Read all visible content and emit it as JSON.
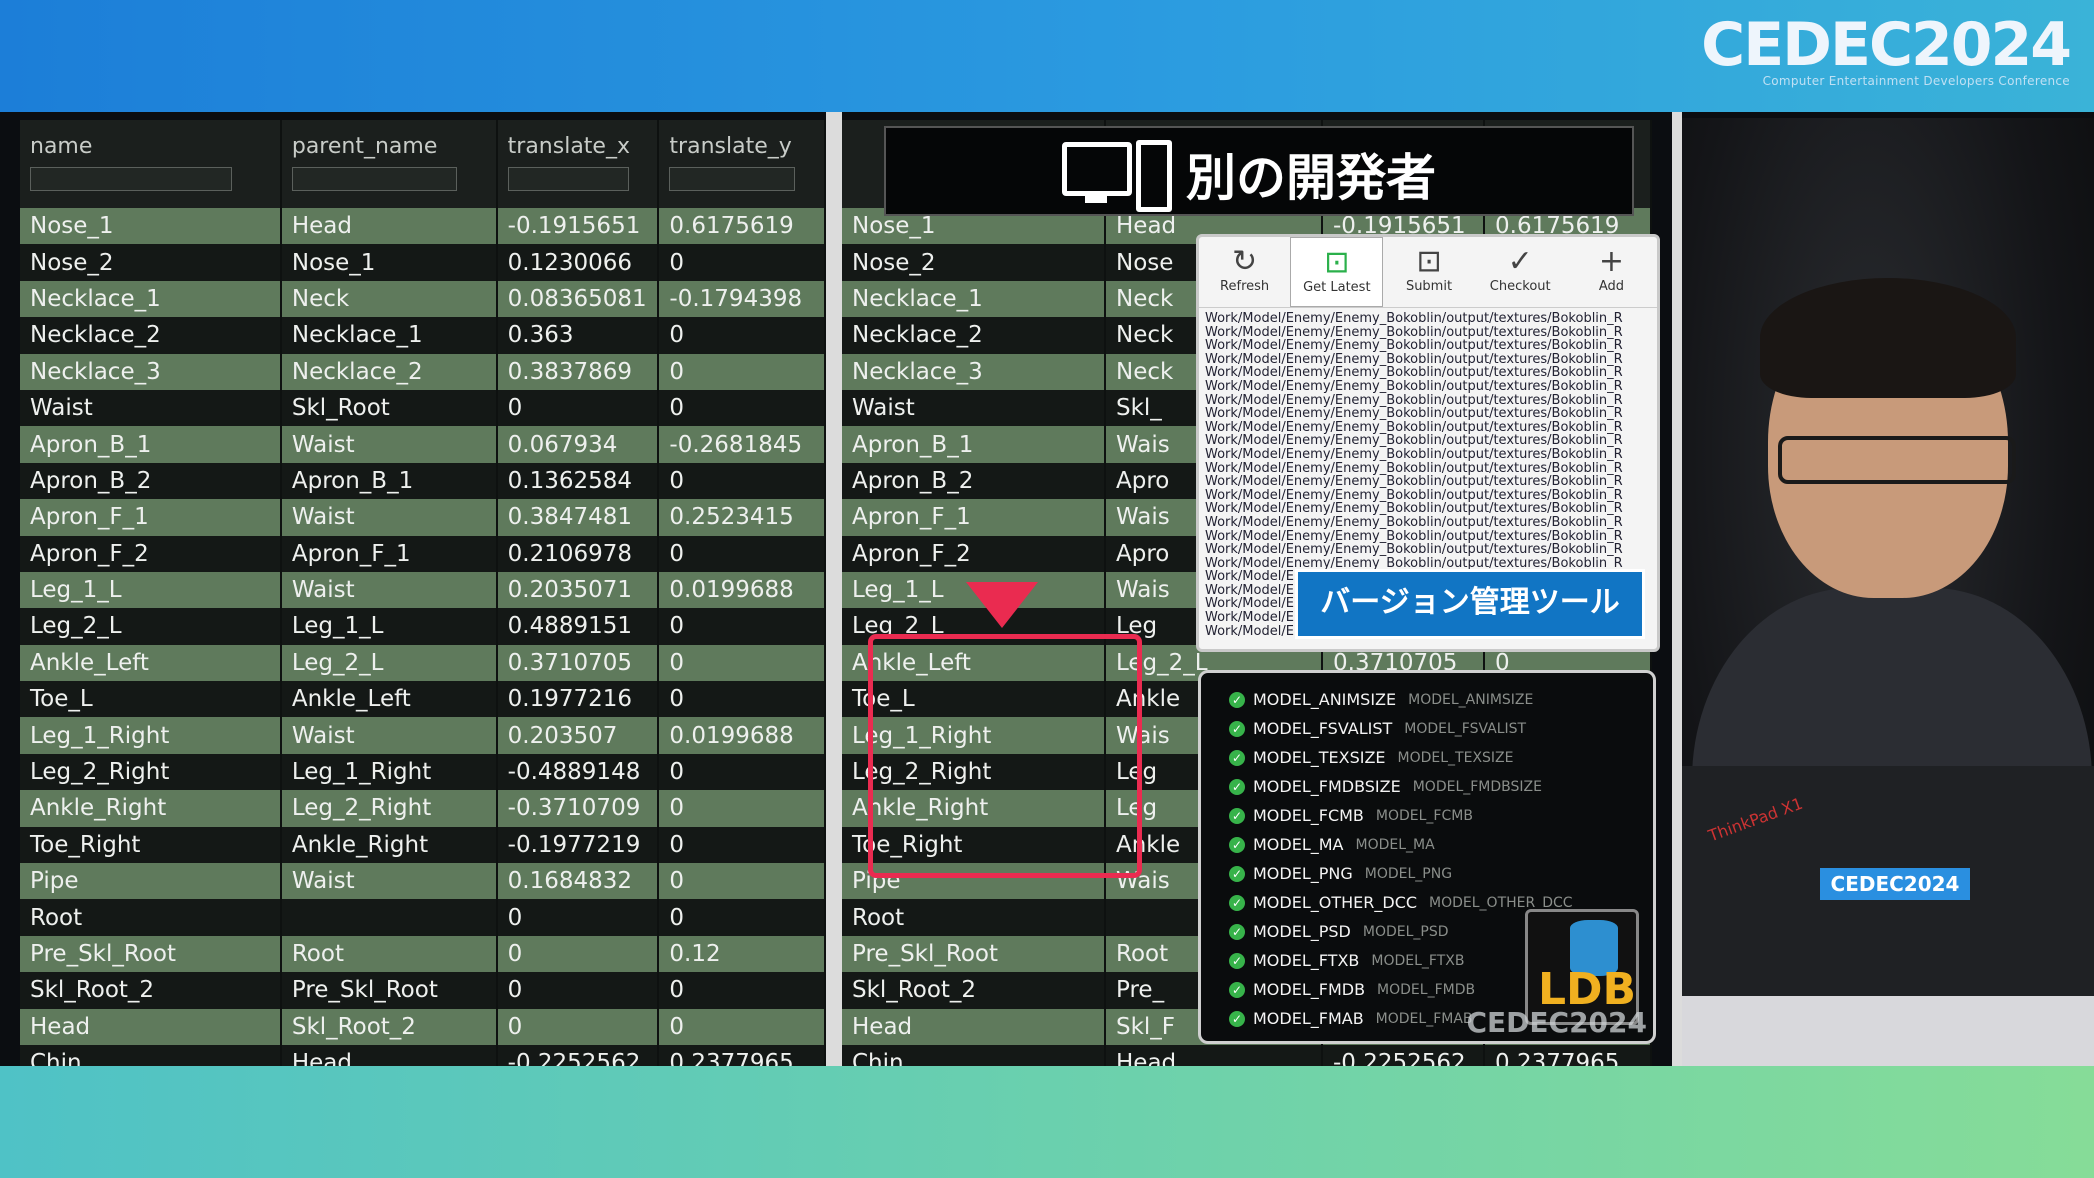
{
  "logo": {
    "main": "CEDEC2024",
    "sub": "Computer Entertainment Developers Conference"
  },
  "table": {
    "headers": [
      "name",
      "parent_name",
      "translate_x",
      "translate_y"
    ],
    "rows": [
      [
        "Nose_1",
        "Head",
        "-0.1915651",
        "0.6175619"
      ],
      [
        "Nose_2",
        "Nose_1",
        "0.1230066",
        "0"
      ],
      [
        "Necklace_1",
        "Neck",
        "0.08365081",
        "-0.1794398"
      ],
      [
        "Necklace_2",
        "Necklace_1",
        "0.363",
        "0"
      ],
      [
        "Necklace_3",
        "Necklace_2",
        "0.3837869",
        "0"
      ],
      [
        "Waist",
        "Skl_Root",
        "0",
        "0"
      ],
      [
        "Apron_B_1",
        "Waist",
        "0.067934",
        "-0.2681845"
      ],
      [
        "Apron_B_2",
        "Apron_B_1",
        "0.1362584",
        "0"
      ],
      [
        "Apron_F_1",
        "Waist",
        "0.3847481",
        "0.2523415"
      ],
      [
        "Apron_F_2",
        "Apron_F_1",
        "0.2106978",
        "0"
      ],
      [
        "Leg_1_L",
        "Waist",
        "0.2035071",
        "0.0199688"
      ],
      [
        "Leg_2_L",
        "Leg_1_L",
        "0.4889151",
        "0"
      ],
      [
        "Ankle_Left",
        "Leg_2_L",
        "0.3710705",
        "0"
      ],
      [
        "Toe_L",
        "Ankle_Left",
        "0.1977216",
        "0"
      ],
      [
        "Leg_1_Right",
        "Waist",
        "0.203507",
        "0.0199688"
      ],
      [
        "Leg_2_Right",
        "Leg_1_Right",
        "-0.4889148",
        "0"
      ],
      [
        "Ankle_Right",
        "Leg_2_Right",
        "-0.3710709",
        "0"
      ],
      [
        "Toe_Right",
        "Ankle_Right",
        "-0.1977219",
        "0"
      ],
      [
        "Pipe",
        "Waist",
        "0.1684832",
        "0"
      ],
      [
        "Root",
        "",
        "0",
        "0"
      ],
      [
        "Pre_Skl_Root",
        "Root",
        "0",
        "0.12"
      ],
      [
        "Skl_Root_2",
        "Pre_Skl_Root",
        "0",
        "0"
      ],
      [
        "Head",
        "Skl_Root_2",
        "0",
        "0"
      ],
      [
        "Chin",
        "Head",
        "-0.2252562",
        "0.2377965"
      ]
    ]
  },
  "right_table": {
    "rows": [
      [
        "Nose_1",
        "Head",
        "-0.1915651",
        "0.6175619"
      ],
      [
        "Nose_2",
        "Nose",
        "",
        ""
      ],
      [
        "Necklace_1",
        "Neck",
        "",
        ""
      ],
      [
        "Necklace_2",
        "Neck",
        "",
        ""
      ],
      [
        "Necklace_3",
        "Neck",
        "",
        ""
      ],
      [
        "Waist",
        "Skl_",
        "",
        ""
      ],
      [
        "Apron_B_1",
        "Wais",
        "",
        ""
      ],
      [
        "Apron_B_2",
        "Apro",
        "",
        ""
      ],
      [
        "Apron_F_1",
        "Wais",
        "",
        ""
      ],
      [
        "Apron_F_2",
        "Apro",
        "",
        ""
      ],
      [
        "Leg_1_L",
        "Wais",
        "",
        ""
      ],
      [
        "Leg_2_L",
        "Leg",
        "",
        ""
      ],
      [
        "Ankle_Left",
        "Leg_2_L",
        "0.3710705",
        "0"
      ],
      [
        "Toe_L",
        "Ankle",
        "",
        ""
      ],
      [
        "Leg_1_Right",
        "Wais",
        "",
        ""
      ],
      [
        "Leg_2_Right",
        "Leg",
        "",
        ""
      ],
      [
        "Ankle_Right",
        "Leg",
        "",
        ""
      ],
      [
        "Toe_Right",
        "Ankle",
        "",
        ""
      ],
      [
        "Pipe",
        "Wais",
        "",
        ""
      ],
      [
        "Root",
        "",
        "",
        ""
      ],
      [
        "Pre_Skl_Root",
        "Root",
        "",
        ""
      ],
      [
        "Skl_Root_2",
        "Pre_",
        "",
        ""
      ],
      [
        "Head",
        "Skl_F",
        "",
        ""
      ],
      [
        "Chin",
        "Head",
        "-0.2252562",
        "0.2377965"
      ]
    ]
  },
  "title_box": {
    "text": "別の開発者"
  },
  "vcs": {
    "tools": [
      {
        "label": "Refresh",
        "icon": "↻"
      },
      {
        "label": "Get Latest",
        "icon": "⊡"
      },
      {
        "label": "Submit",
        "icon": "⊡"
      },
      {
        "label": "Checkout",
        "icon": "✓"
      },
      {
        "label": "Add",
        "icon": "+"
      }
    ],
    "path_line": "Work/Model/Enemy/Enemy_Bokoblin/output/textures/Bokoblin_R",
    "banner": "バージョン管理ツール"
  },
  "ldb": {
    "items": [
      [
        "MODEL_ANIMSIZE",
        "MODEL_ANIMSIZE"
      ],
      [
        "MODEL_FSVALIST",
        "MODEL_FSVALIST"
      ],
      [
        "MODEL_TEXSIZE",
        "MODEL_TEXSIZE"
      ],
      [
        "MODEL_FMDBSIZE",
        "MODEL_FMDBSIZE"
      ],
      [
        "MODEL_FCMB",
        "MODEL_FCMB"
      ],
      [
        "MODEL_MA",
        "MODEL_MA"
      ],
      [
        "MODEL_PNG",
        "MODEL_PNG"
      ],
      [
        "MODEL_OTHER_DCC",
        "MODEL_OTHER_DCC"
      ],
      [
        "MODEL_PSD",
        "MODEL_PSD"
      ],
      [
        "MODEL_FTXB",
        "MODEL_FTXB"
      ],
      [
        "MODEL_FMDB",
        "MODEL_FMDB"
      ],
      [
        "MODEL_FMAB",
        "MODEL_FMAB"
      ]
    ],
    "logo_text": "LDB",
    "watermark": "CEDEC2024"
  },
  "laptop_sticker": "CEDEC2024",
  "laptop_brand": "ThinkPad X1",
  "colors": {
    "accent": "#1175c4",
    "highlight": "#ea2b50",
    "row_alt": "#5f7a5c"
  }
}
